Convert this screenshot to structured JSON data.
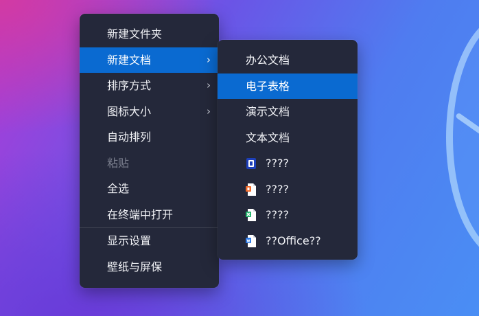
{
  "main_menu": {
    "items": [
      {
        "label": "新建文件夹",
        "has_submenu": false,
        "state": "normal"
      },
      {
        "label": "新建文档",
        "has_submenu": true,
        "state": "active"
      },
      {
        "label": "排序方式",
        "has_submenu": true,
        "state": "normal"
      },
      {
        "label": "图标大小",
        "has_submenu": true,
        "state": "normal"
      },
      {
        "label": "自动排列",
        "has_submenu": false,
        "state": "normal"
      },
      {
        "label": "粘贴",
        "has_submenu": false,
        "state": "disabled"
      },
      {
        "label": "全选",
        "has_submenu": false,
        "state": "normal"
      },
      {
        "label": "在终端中打开",
        "has_submenu": false,
        "state": "normal"
      },
      {
        "label": "显示设置",
        "has_submenu": false,
        "state": "normal"
      },
      {
        "label": "壁纸与屏保",
        "has_submenu": false,
        "state": "normal"
      }
    ],
    "arrow": "›"
  },
  "sub_menu": {
    "items": [
      {
        "label": "办公文档",
        "icon": null,
        "state": "normal"
      },
      {
        "label": "电子表格",
        "icon": null,
        "state": "active"
      },
      {
        "label": "演示文档",
        "icon": null,
        "state": "normal"
      },
      {
        "label": "文本文档",
        "icon": null,
        "state": "normal"
      },
      {
        "label": "????",
        "icon": "blue-document-app-icon",
        "state": "normal"
      },
      {
        "label": "????",
        "icon": "orange-presentation-file-icon",
        "state": "normal"
      },
      {
        "label": "????",
        "icon": "green-spreadsheet-file-icon",
        "state": "normal"
      },
      {
        "label": "??Office??",
        "icon": "blue-writer-file-icon",
        "state": "normal"
      }
    ]
  },
  "colors": {
    "menu_bg": "#24283a",
    "highlight": "#0a6ad1",
    "text": "#f2f3f7",
    "disabled_text": "#7b7f8e"
  }
}
